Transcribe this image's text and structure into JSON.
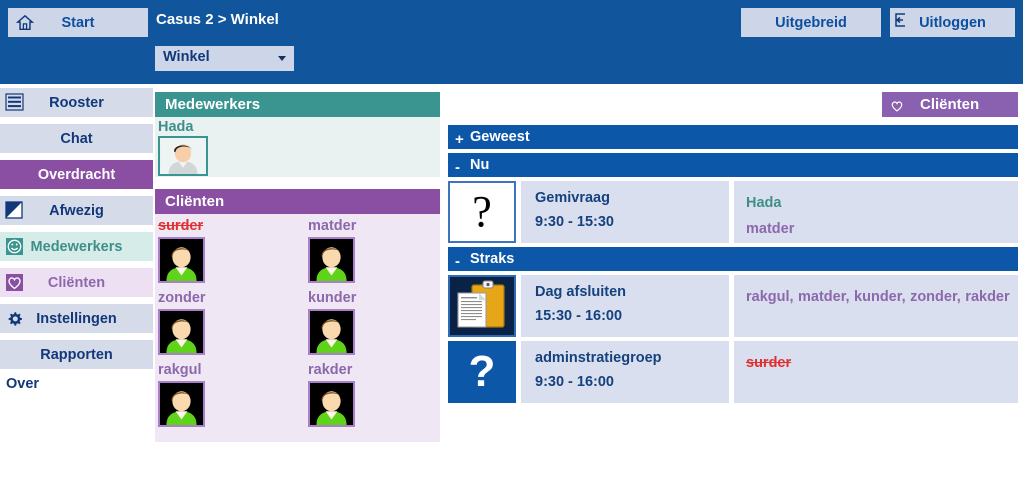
{
  "topbar": {
    "start_label": "Start",
    "home_icon": "home-icon",
    "breadcrumb": "Casus 2 > Winkel",
    "location_select_value": "Winkel",
    "uitgebreid_label": "Uitgebreid",
    "uitloggen_label": "Uitloggen",
    "logout_icon": "logout-icon",
    "bg_color": "#11559c",
    "button_bg": "#ccd6e8"
  },
  "sidebar": {
    "items": [
      {
        "label": "Rooster",
        "icon": "menu-icon",
        "state": "normal"
      },
      {
        "label": "Chat",
        "icon": "",
        "state": "normal"
      },
      {
        "label": "Overdracht",
        "icon": "",
        "state": "active"
      },
      {
        "label": "Afwezig",
        "icon": "half-square-icon",
        "state": "normal"
      },
      {
        "label": "Medewerkers",
        "icon": "smiley-icon",
        "state": "teal"
      },
      {
        "label": "Cliënten",
        "icon": "heart-icon",
        "state": "purple"
      },
      {
        "label": "Instellingen",
        "icon": "gear-icon",
        "state": "normal"
      },
      {
        "label": "Rapporten",
        "icon": "",
        "state": "normal"
      }
    ],
    "over_label": "Over",
    "active_color": "#8a4fa3"
  },
  "employees_panel": {
    "title": "Medewerkers",
    "header_color": "#3a9490",
    "employees": [
      {
        "name": "Hada",
        "avatar": "employee-avatar"
      }
    ]
  },
  "clients_panel": {
    "title": "Cliënten",
    "header_color": "#8a4fa3",
    "clients": [
      {
        "name": "surder",
        "struck": true
      },
      {
        "name": "matder",
        "struck": false
      },
      {
        "name": "zonder",
        "struck": false
      },
      {
        "name": "kunder",
        "struck": false
      },
      {
        "name": "rakgul",
        "struck": false
      },
      {
        "name": "rakder",
        "struck": false
      }
    ]
  },
  "clients_badge": {
    "label": "Cliënten",
    "icon": "heart-icon",
    "color": "#8a60b0"
  },
  "sections": [
    {
      "key": "geweest",
      "title": "Geweest",
      "toggle": "+",
      "expanded": false,
      "events": []
    },
    {
      "key": "nu",
      "title": "Nu",
      "toggle": "-",
      "expanded": true,
      "events": [
        {
          "icon": "question-mark-white-icon",
          "title": "Gemivraag",
          "time": "9:30 - 15:30",
          "people": [
            {
              "name": "Hada",
              "type": "employee"
            },
            {
              "name": "matder",
              "type": "client"
            }
          ]
        }
      ]
    },
    {
      "key": "straks",
      "title": "Straks",
      "toggle": "-",
      "expanded": true,
      "events": [
        {
          "icon": "clipboard-icon",
          "title": "Dag afsluiten",
          "time": "15:30 - 16:00",
          "people": [
            {
              "name": "rakgul,",
              "type": "client"
            },
            {
              "name": "matder,",
              "type": "client"
            },
            {
              "name": "kunder,",
              "type": "client"
            },
            {
              "name": "zonder,",
              "type": "client"
            },
            {
              "name": "rakder",
              "type": "client"
            }
          ]
        },
        {
          "icon": "question-mark-blue-icon",
          "title": "adminstratiegroep",
          "time": "9:30 - 16:00",
          "people": [
            {
              "name": "surder",
              "type": "client-struck"
            }
          ]
        }
      ]
    }
  ]
}
